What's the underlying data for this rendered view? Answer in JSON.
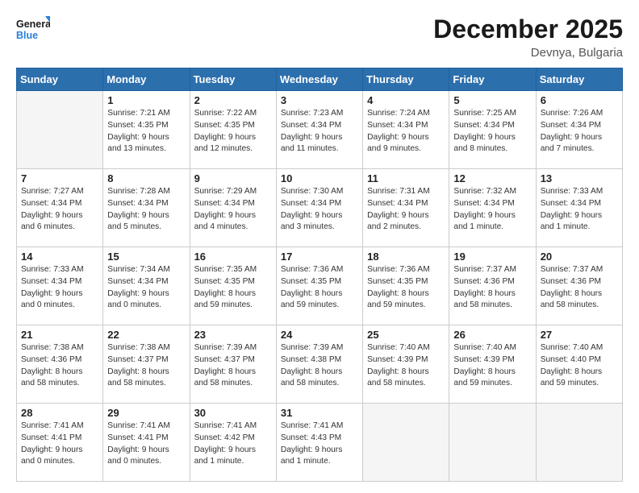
{
  "header": {
    "logo_general": "General",
    "logo_blue": "Blue",
    "month_title": "December 2025",
    "subtitle": "Devnya, Bulgaria"
  },
  "weekdays": [
    "Sunday",
    "Monday",
    "Tuesday",
    "Wednesday",
    "Thursday",
    "Friday",
    "Saturday"
  ],
  "weeks": [
    [
      {
        "day": "",
        "info": ""
      },
      {
        "day": "1",
        "info": "Sunrise: 7:21 AM\nSunset: 4:35 PM\nDaylight: 9 hours\nand 13 minutes."
      },
      {
        "day": "2",
        "info": "Sunrise: 7:22 AM\nSunset: 4:35 PM\nDaylight: 9 hours\nand 12 minutes."
      },
      {
        "day": "3",
        "info": "Sunrise: 7:23 AM\nSunset: 4:34 PM\nDaylight: 9 hours\nand 11 minutes."
      },
      {
        "day": "4",
        "info": "Sunrise: 7:24 AM\nSunset: 4:34 PM\nDaylight: 9 hours\nand 9 minutes."
      },
      {
        "day": "5",
        "info": "Sunrise: 7:25 AM\nSunset: 4:34 PM\nDaylight: 9 hours\nand 8 minutes."
      },
      {
        "day": "6",
        "info": "Sunrise: 7:26 AM\nSunset: 4:34 PM\nDaylight: 9 hours\nand 7 minutes."
      }
    ],
    [
      {
        "day": "7",
        "info": "Sunrise: 7:27 AM\nSunset: 4:34 PM\nDaylight: 9 hours\nand 6 minutes."
      },
      {
        "day": "8",
        "info": "Sunrise: 7:28 AM\nSunset: 4:34 PM\nDaylight: 9 hours\nand 5 minutes."
      },
      {
        "day": "9",
        "info": "Sunrise: 7:29 AM\nSunset: 4:34 PM\nDaylight: 9 hours\nand 4 minutes."
      },
      {
        "day": "10",
        "info": "Sunrise: 7:30 AM\nSunset: 4:34 PM\nDaylight: 9 hours\nand 3 minutes."
      },
      {
        "day": "11",
        "info": "Sunrise: 7:31 AM\nSunset: 4:34 PM\nDaylight: 9 hours\nand 2 minutes."
      },
      {
        "day": "12",
        "info": "Sunrise: 7:32 AM\nSunset: 4:34 PM\nDaylight: 9 hours\nand 1 minute."
      },
      {
        "day": "13",
        "info": "Sunrise: 7:33 AM\nSunset: 4:34 PM\nDaylight: 9 hours\nand 1 minute."
      }
    ],
    [
      {
        "day": "14",
        "info": "Sunrise: 7:33 AM\nSunset: 4:34 PM\nDaylight: 9 hours\nand 0 minutes."
      },
      {
        "day": "15",
        "info": "Sunrise: 7:34 AM\nSunset: 4:34 PM\nDaylight: 9 hours\nand 0 minutes."
      },
      {
        "day": "16",
        "info": "Sunrise: 7:35 AM\nSunset: 4:35 PM\nDaylight: 8 hours\nand 59 minutes."
      },
      {
        "day": "17",
        "info": "Sunrise: 7:36 AM\nSunset: 4:35 PM\nDaylight: 8 hours\nand 59 minutes."
      },
      {
        "day": "18",
        "info": "Sunrise: 7:36 AM\nSunset: 4:35 PM\nDaylight: 8 hours\nand 59 minutes."
      },
      {
        "day": "19",
        "info": "Sunrise: 7:37 AM\nSunset: 4:36 PM\nDaylight: 8 hours\nand 58 minutes."
      },
      {
        "day": "20",
        "info": "Sunrise: 7:37 AM\nSunset: 4:36 PM\nDaylight: 8 hours\nand 58 minutes."
      }
    ],
    [
      {
        "day": "21",
        "info": "Sunrise: 7:38 AM\nSunset: 4:36 PM\nDaylight: 8 hours\nand 58 minutes."
      },
      {
        "day": "22",
        "info": "Sunrise: 7:38 AM\nSunset: 4:37 PM\nDaylight: 8 hours\nand 58 minutes."
      },
      {
        "day": "23",
        "info": "Sunrise: 7:39 AM\nSunset: 4:37 PM\nDaylight: 8 hours\nand 58 minutes."
      },
      {
        "day": "24",
        "info": "Sunrise: 7:39 AM\nSunset: 4:38 PM\nDaylight: 8 hours\nand 58 minutes."
      },
      {
        "day": "25",
        "info": "Sunrise: 7:40 AM\nSunset: 4:39 PM\nDaylight: 8 hours\nand 58 minutes."
      },
      {
        "day": "26",
        "info": "Sunrise: 7:40 AM\nSunset: 4:39 PM\nDaylight: 8 hours\nand 59 minutes."
      },
      {
        "day": "27",
        "info": "Sunrise: 7:40 AM\nSunset: 4:40 PM\nDaylight: 8 hours\nand 59 minutes."
      }
    ],
    [
      {
        "day": "28",
        "info": "Sunrise: 7:41 AM\nSunset: 4:41 PM\nDaylight: 9 hours\nand 0 minutes."
      },
      {
        "day": "29",
        "info": "Sunrise: 7:41 AM\nSunset: 4:41 PM\nDaylight: 9 hours\nand 0 minutes."
      },
      {
        "day": "30",
        "info": "Sunrise: 7:41 AM\nSunset: 4:42 PM\nDaylight: 9 hours\nand 1 minute."
      },
      {
        "day": "31",
        "info": "Sunrise: 7:41 AM\nSunset: 4:43 PM\nDaylight: 9 hours\nand 1 minute."
      },
      {
        "day": "",
        "info": ""
      },
      {
        "day": "",
        "info": ""
      },
      {
        "day": "",
        "info": ""
      }
    ]
  ]
}
